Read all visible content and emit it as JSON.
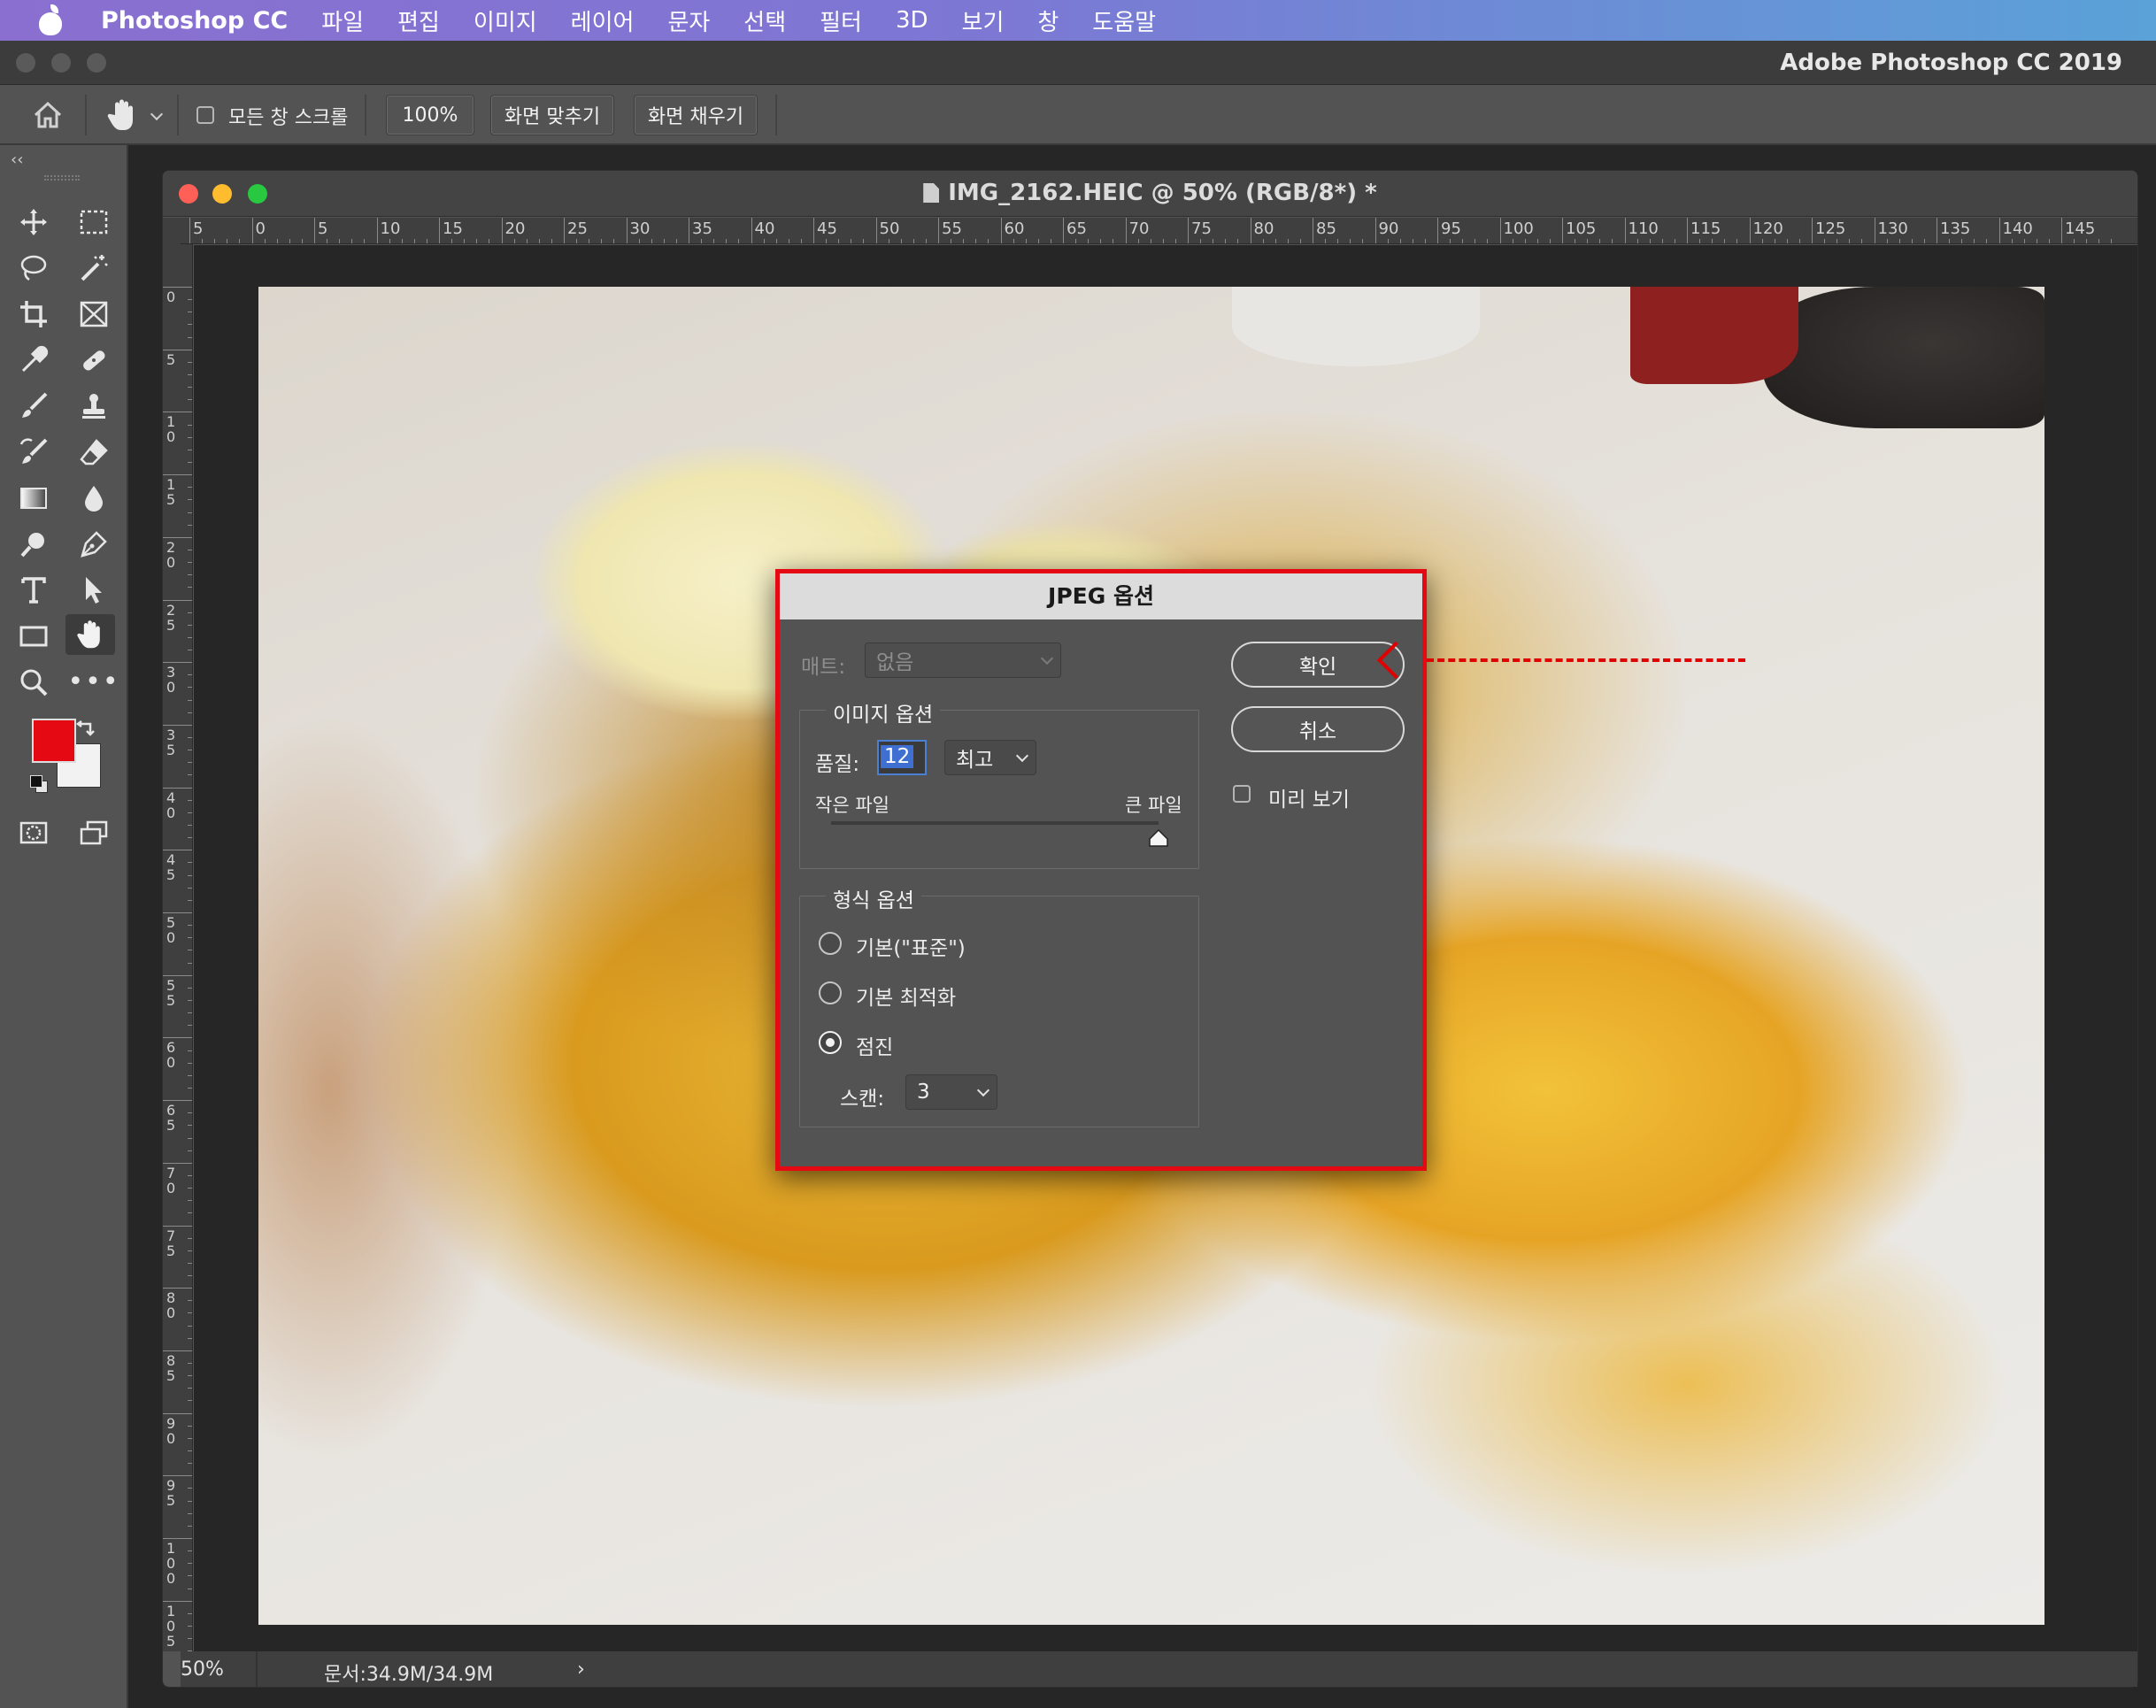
{
  "menubar": {
    "app": "Photoshop CC",
    "items": [
      "파일",
      "편집",
      "이미지",
      "레이어",
      "문자",
      "선택",
      "필터",
      "3D",
      "보기",
      "창",
      "도움말"
    ]
  },
  "window": {
    "title": "Adobe Photoshop CC 2019"
  },
  "options": {
    "scroll_all_label": "모든 창 스크롤",
    "zoom_btn": "100%",
    "fit_btn": "화면 맞추기",
    "fill_btn": "화면 채우기"
  },
  "document": {
    "title": "IMG_2162.HEIC @ 50% (RGB/8*) *",
    "ruler_h": [
      "5",
      "0",
      "5",
      "10",
      "15",
      "20",
      "25",
      "30",
      "35",
      "40",
      "45",
      "50",
      "55",
      "60",
      "65",
      "70",
      "75",
      "80",
      "85",
      "90",
      "95",
      "100",
      "105",
      "110",
      "115",
      "120",
      "125",
      "130",
      "135",
      "140",
      "145"
    ],
    "ruler_v": [
      "0",
      "5",
      "1 0",
      "1 5",
      "2 0",
      "2 5",
      "3 0",
      "3 5",
      "4 0",
      "4 5",
      "5 0",
      "5 5",
      "6 0",
      "6 5",
      "7 0",
      "7 5",
      "8 0",
      "8 5",
      "9 0",
      "9 5",
      "1 0 0",
      "1 0 5"
    ],
    "zoom": "50%",
    "doc_size": "문서:34.9M/34.9M"
  },
  "dialog": {
    "title": "JPEG 옵션",
    "matte_label": "매트:",
    "matte_value": "없음",
    "image_options_title": "이미지 옵션",
    "quality_label": "품질:",
    "quality_value": "12",
    "quality_preset": "최고",
    "small_file": "작은 파일",
    "large_file": "큰 파일",
    "quality_slider": 1.0,
    "format_options_title": "형식 옵션",
    "format_baseline": "기본(\"표준\")",
    "format_optimized": "기본 최적화",
    "format_progressive": "점진",
    "scan_label": "스캔:",
    "scan_value": "3",
    "ok": "확인",
    "cancel": "취소",
    "preview": "미리 보기"
  },
  "colors": {
    "foreground": "#e50914",
    "background": "#f2f2f2",
    "highlight": "#e50914"
  }
}
